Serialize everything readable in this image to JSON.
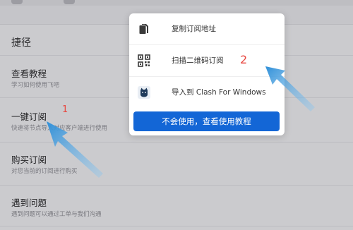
{
  "shortcuts": {
    "section_title": "捷径",
    "items": [
      {
        "title": "查看教程",
        "subtitle": "学习如何使用飞吧"
      },
      {
        "title": "一键订阅",
        "subtitle": "快速将节点导入对应客户端进行使用"
      },
      {
        "title": "购买订阅",
        "subtitle": "对您当前的订阅进行购买"
      },
      {
        "title": "遇到问题",
        "subtitle": "遇到问题可以通过工单与我们沟通"
      }
    ]
  },
  "popup": {
    "items": [
      {
        "label": "复制订阅地址",
        "icon": "copy-icon"
      },
      {
        "label": "扫描二维码订阅",
        "icon": "qr-code-icon"
      },
      {
        "label": "导入到 Clash For Windows",
        "icon": "clash-cat-icon"
      }
    ],
    "primary_button": "不会使用，查看使用教程"
  },
  "annotations": {
    "marker_1": "1",
    "marker_2": "2",
    "arrow_color": "#3a9fe0",
    "marker_color": "#e8463f"
  },
  "colors": {
    "primary": "#1366d6"
  }
}
